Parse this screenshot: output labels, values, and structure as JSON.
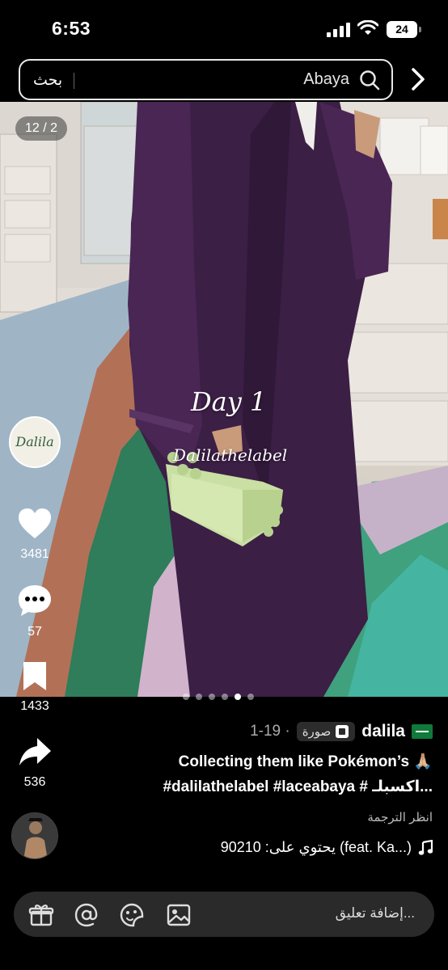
{
  "status_bar": {
    "time": "6:53",
    "battery": "24"
  },
  "search": {
    "button_label": "بحث",
    "query": "Abaya"
  },
  "photo": {
    "counter": "12 / 2",
    "overlay_day": "Day 1",
    "overlay_brand": "Dalilathelabel",
    "brand_logo_text": "Dalila",
    "slide_count": 6,
    "active_slide": 5
  },
  "actions": {
    "likes": "3481",
    "comments": "57",
    "saves": "1433",
    "shares": "536"
  },
  "post": {
    "author": "dalila",
    "type_tag": "صورة",
    "date": "1-19 ·",
    "title": "Collecting them like Pokémon’s 🙏🏼",
    "tags": "#dalilathelabel #laceabaya # اكسبلـ...",
    "see_translation": "انظر الترجمة",
    "music": "يحتوي على: 90210 (feat. Ka...)"
  },
  "comment": {
    "placeholder": "إضافة تعليق..."
  },
  "colors": {
    "background": "#000000",
    "abaya": "#3b1f45",
    "accent_flag": "#0f7a3a"
  }
}
